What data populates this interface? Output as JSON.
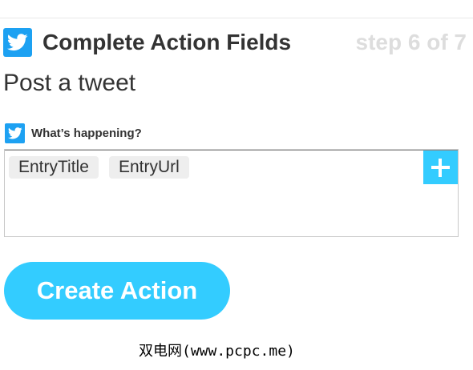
{
  "header": {
    "icon": "twitter-bird-icon",
    "title": "Complete Action Fields",
    "step": "step 6 of 7"
  },
  "action": {
    "title": "Post a tweet"
  },
  "field": {
    "icon": "twitter-bird-icon",
    "label": "What’s happening?",
    "ingredients": [
      "EntryTitle",
      "EntryUrl"
    ],
    "add_icon": "plus-icon"
  },
  "footer": {
    "create_label": "Create Action"
  },
  "watermark": "双电网(www.pcpc.me)",
  "colors": {
    "twitter_blue": "#1da1f2",
    "accent": "#33ccff",
    "step_gray": "#dddddd",
    "pill_bg": "#eeeeee"
  }
}
